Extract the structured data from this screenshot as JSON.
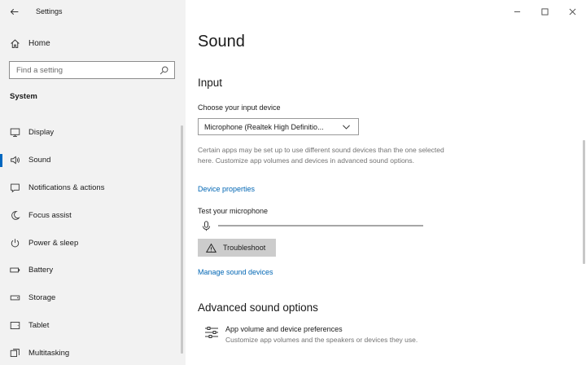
{
  "window": {
    "title": "Settings"
  },
  "sidebar": {
    "home_label": "Home",
    "search_placeholder": "Find a setting",
    "section_title": "System",
    "items": [
      {
        "label": "Display",
        "icon": "monitor-icon"
      },
      {
        "label": "Sound",
        "icon": "speaker-icon",
        "selected": true
      },
      {
        "label": "Notifications & actions",
        "icon": "notification-icon"
      },
      {
        "label": "Focus assist",
        "icon": "moon-icon"
      },
      {
        "label": "Power & sleep",
        "icon": "power-icon"
      },
      {
        "label": "Battery",
        "icon": "battery-icon"
      },
      {
        "label": "Storage",
        "icon": "storage-icon"
      },
      {
        "label": "Tablet",
        "icon": "tablet-icon"
      },
      {
        "label": "Multitasking",
        "icon": "multitasking-icon"
      }
    ]
  },
  "main": {
    "page_title": "Sound",
    "input_heading": "Input",
    "choose_device_label": "Choose your input device",
    "input_device_value": "Microphone (Realtek High Definitio...",
    "description": "Certain apps may be set up to use different sound devices than the one selected here. Customize app volumes and devices in advanced sound options.",
    "device_properties_link": "Device properties",
    "test_mic_label": "Test your microphone",
    "mic_level": 0,
    "troubleshoot_label": "Troubleshoot",
    "manage_devices_link": "Manage sound devices",
    "advanced_heading": "Advanced sound options",
    "app_volume_title": "App volume and device preferences",
    "app_volume_desc": "Customize app volumes and the speakers or devices they use."
  },
  "colors": {
    "accent": "#0067c0",
    "link": "#0066b4",
    "sidebar_bg": "#f2f2f2",
    "button_bg": "#cccccc"
  }
}
